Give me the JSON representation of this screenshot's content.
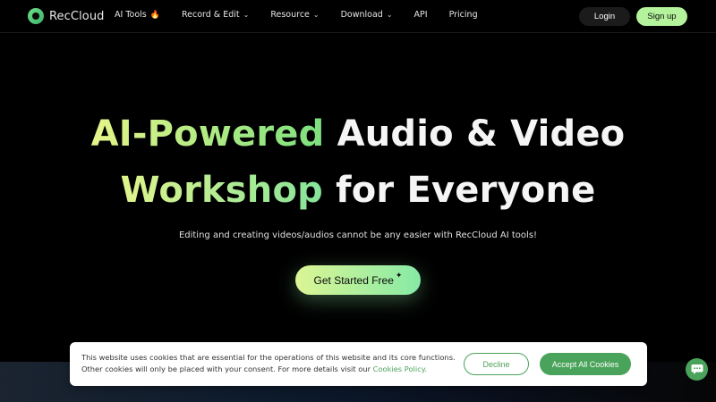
{
  "brand": {
    "name": "RecCloud",
    "accent": "#4aa35a",
    "highlight": "#b4f29c"
  },
  "nav": {
    "items": [
      {
        "label": "AI Tools",
        "icon": "fire-icon",
        "dropdown": false
      },
      {
        "label": "Record & Edit",
        "dropdown": true
      },
      {
        "label": "Resource",
        "dropdown": true
      },
      {
        "label": "Download",
        "dropdown": true
      },
      {
        "label": "API",
        "dropdown": false
      },
      {
        "label": "Pricing",
        "dropdown": false
      }
    ],
    "fire_glyph": "🔥",
    "chevron_glyph": "⌄",
    "login_label": "Login",
    "signup_label": "Sign up"
  },
  "hero": {
    "line1_highlight": "AI-Powered",
    "line1_rest": " Audio & Video",
    "line2_highlight": "Workshop",
    "line2_rest": " for Everyone",
    "subtitle": "Editing and creating videos/audios cannot be any easier with RecCloud AI tools!",
    "cta_label": "Get Started Free",
    "cta_spark": "✦"
  },
  "cookie": {
    "text": "This website uses cookies that are essential for the operations of this website and its core functions. Other cookies will only be placed with your consent. For more details visit our ",
    "link_label": "Cookies Policy.",
    "decline_label": "Decline",
    "accept_label": "Accept All Cookies"
  },
  "chat": {
    "icon": "chat-bubble-icon"
  }
}
